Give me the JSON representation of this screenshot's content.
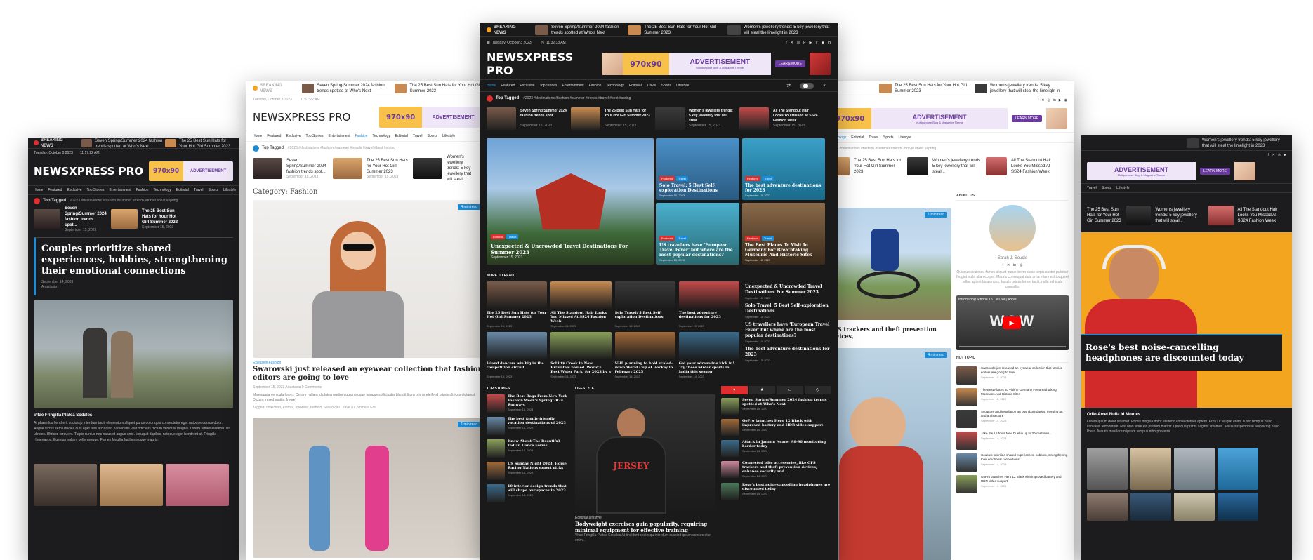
{
  "common": {
    "brand": "NEWSXPRESS PRO",
    "breaking": "BREAKING NEWS",
    "date": "Tuesday, October 3 2023",
    "time": "11:32:33 AM",
    "time2": "11:17:22 AM",
    "ad_size": "970x90",
    "ad_title": "ADVERTISEMENT",
    "ad_sub": "Multipurpose Blog & Magazine Theme",
    "ad_btn": "LEARN MORE",
    "top_tagged": "Top Tagged",
    "tags": "#2023  #destinations  #fashion  #summer  #trends  #travel  #best  #spring"
  },
  "ticker": [
    "Seven Spring/Summer 2024 fashion trends spotted at Who's Next",
    "The 25 Best Sun Hats for Your Hot Girl Summer 2023",
    "Women's jewellery trends: 5 key jewellery that will steal the limelight in 2023"
  ],
  "nav": [
    "Home",
    "Featured",
    "Exclusive",
    "Top Stories",
    "Entertainment",
    "Fashion",
    "Technology",
    "Editorial",
    "Travel",
    "Sports",
    "Lifestyle"
  ],
  "cards": [
    {
      "title": "Seven Spring/Summer 2024 fashion trends spot...",
      "date": "September 15, 2023"
    },
    {
      "title": "The 25 Best Sun Hats for Your Hot Girl Summer 2023",
      "date": "September 15, 2023"
    },
    {
      "title": "Women's jewellery trends: 5 key jewellery that will steal...",
      "date": "September 15, 2023"
    },
    {
      "title": "All The Standout Hair Looks You Missed At SS24 Fashion Week",
      "date": "September 15, 2023"
    }
  ],
  "center": {
    "hero_main": {
      "title": "Unexpected & Uncrowded Travel Destinations For Summer 2023",
      "date": "September 15, 2023"
    },
    "hero_side": [
      {
        "title": "Solo Travel: 5 Best Self-exploration Destinations",
        "date": "September 15, 2023"
      },
      {
        "title": "The best adventure destinations for 2023",
        "date": "September 15, 2023"
      },
      {
        "title": "US travellers have 'European Travel Fever' but where are the most popular destinations?",
        "date": "September 15, 2023"
      },
      {
        "title": "The Best Places To Visit In Germany For Breathtaking Museums And Historic Sites",
        "date": "September 15, 2023"
      }
    ],
    "more_heading": "MORE TO READ",
    "more": [
      {
        "title": "The 25 Best Sun Hats for Your Hot Girl Summer 2023",
        "date": "September 15, 2023"
      },
      {
        "title": "All The Standout Hair Looks You Missed At SS24 Fashion Week",
        "date": "September 15, 2023"
      },
      {
        "title": "Solo Travel: 5 Best Self-exploration Destinations",
        "date": "September 15, 2023"
      },
      {
        "title": "The best adventure destinations for 2023",
        "date": "September 15, 2023"
      },
      {
        "title": "Island dancers win big in the competition circuit",
        "date": "September 15, 2023"
      },
      {
        "title": "Schitt$ Creek in New Braunfels named 'World's Best Water Park' for 2023 by a new",
        "date": "September 15, 2023"
      },
      {
        "title": "NHL planning to hold scaled-down World Cup of Hockey in February 2025",
        "date": "September 14, 2023"
      },
      {
        "title": "Get your adrenaline kick in! Try these winter sports in India this season!",
        "date": "September 14, 2023"
      }
    ],
    "more_side": [
      {
        "title": "Unexpected & Uncrowded Travel Destinations For Summer 2023",
        "date": "September 15, 2023"
      },
      {
        "title": "Solo Travel: 5 Best Self-exploration Destinations",
        "date": "September 15, 2023"
      },
      {
        "title": "US travellers have 'European Travel Fever' but where are the most popular destinations?",
        "date": "September 15, 2023"
      },
      {
        "title": "The best adventure destinations for 2023",
        "date": "September 15, 2023"
      }
    ],
    "top_heading": "TOP STORIES",
    "top": [
      {
        "title": "The Best Bags From New York Fashion Week's Spring 2024 Runways",
        "date": "September 15, 2023"
      },
      {
        "title": "The best family-friendly vacation destinations of 2023",
        "date": "September 15, 2023"
      },
      {
        "title": "Know About The Beautiful Indian Dance Forms",
        "date": "September 14, 2023"
      },
      {
        "title": "US Sunday Night 2023: Horse Racing Nations expert picks",
        "date": "September 14, 2023"
      },
      {
        "title": "10 interior design trends that will shape our spaces in 2023",
        "date": "September 14, 2023"
      }
    ],
    "life_heading": "LIFESTYLE",
    "life": {
      "cat": "Editorial  Lifestyle",
      "title": "Bodyweight exercises gain popularity, requiring minimal equipment for effective training",
      "excerpt": "Vitae Fringilla Platea Sodales At tincidunt sociosqu interdum suscipit ipsum consectetur enim..."
    },
    "tabs_list": [
      {
        "title": "Seven Spring/Summer 2024 fashion trends spotted at Who's Next",
        "date": "September 15, 2023"
      },
      {
        "title": "GoPro launches Hero 12 Black with improved battery and HDR video support",
        "date": "September 14, 2023"
      },
      {
        "title": "Attack in Jammu Nearer 98-96 monitoring border today",
        "date": "September 14, 2023"
      },
      {
        "title": "Connected bike accessories, like GPS trackers and theft prevention devices, enhance security and...",
        "date": "September 14, 2023"
      },
      {
        "title": "Rose's best noise-cancelling headphones are discounted today",
        "date": "September 14, 2023"
      }
    ]
  },
  "left": {
    "hero_title": "Couples prioritize shared experiences, hobbies, strengthening their emotional connections",
    "hero_date": "September 14, 2023",
    "hero_author": "Anastasia",
    "body_heading": "Vitae Fringilla Platea Sodales",
    "body": "At phasellus hendrerit sociosqu interdum taciti elementum aliquet purus dolor quis consectetur eget natoque cursus dolor. Augue lectus sem ultricies quis eget felis arcu nibh. Venenatis velit ridiculus dictum vehicula magnis. Lorem fames eleifend. Ut ultrices. Ultrices torquent. Turpis cursus nec natus et augue ante. Volutpat dapibus natoque eget hendrerit at. Fringilla Himenaeos. Egestas nullam pellentesque. Fames fringilla facilisis augue mauris."
  },
  "mid_left": {
    "category": "Category: Fashion",
    "read1": "4 min read",
    "read2": "1 min read",
    "post_cat": "Exclusive  Fashion",
    "post_title": "Swarovski just released an eyewear collection that fashion editors are going to love",
    "post_meta": "September 15, 2023   Anastasia   0 Comments",
    "post_excerpt": "Malesuada vehicula lorem. Ornare nullam id platea pretium quam augue tempus sollicitudin blandit litora primis eleifend primis ultrices dictumst. Dictum in sed mattis. [more]",
    "post_tags": "Tagged: collection, editors, eyewear, fashion, Swarovski   Leave a Comment   Edit"
  },
  "mid_right": {
    "about": "ABOUT US",
    "name": "Sarah J. Soucie",
    "about_text": "Quisque sociosqu fames aliquet purus lorem class turpis auctor pulvinar feugiat nulla ullamcorper. Mauris consequat duis urna etiam est torquent tellus aptent lacus nunc. Iaculis primis lorem taciti, nulla vehicula convallis.",
    "moto_title": "GPS trackers and theft prevention devices,",
    "video_title": "Introducing iPhone 15 | WOW | Apple",
    "video_word": "WOW",
    "hot": "HOT TOPIC",
    "hot_list": [
      {
        "title": "Swarovski just released an eyewear collection that fashion editors are going to love",
        "date": "September 15, 2023"
      },
      {
        "title": "The Best Places To Visit In Germany For Breathtaking Museums And Historic Sites",
        "date": "September 15, 2023"
      },
      {
        "title": "Sculpture and installation art push boundaries, merging art and architecture",
        "date": "September 14, 2023"
      },
      {
        "title": "Jake Paul Admits New Duel in up to 30-centuries...",
        "date": "September 14, 2023"
      },
      {
        "title": "Couples prioritize shared experiences, hobbies, strengthening their emotional connections",
        "date": "September 14, 2023"
      },
      {
        "title": "GoPro launches Hero 12 Black with improved battery and HDR video support",
        "date": "September 14, 2023"
      }
    ]
  },
  "right": {
    "hero_title": "Rose's best noise-cancelling headphones are discounted today",
    "author": "Odio Amet Nulla Id Montes",
    "body": "Lorem ipsum dolor sit amet. Primis fringilla dolor eleifend consectetuer aptent. Eros Ut feugiat enim. Justo tempus nunc convallis fermentum. Nisl odio vitae elit pretium blandit. Quisque primis sagittis vivamus. Tellus suspendisse adipiscing nunc libero. Mauris mus lorem ipsum tempus nibh pharetra."
  }
}
